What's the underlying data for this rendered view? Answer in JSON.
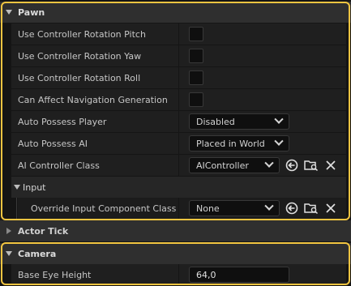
{
  "pawn": {
    "title": "Pawn",
    "rows": [
      {
        "label": "Use Controller Rotation Pitch"
      },
      {
        "label": "Use Controller Rotation Yaw"
      },
      {
        "label": "Use Controller Rotation Roll"
      },
      {
        "label": "Can Affect Navigation Generation"
      },
      {
        "label": "Auto Possess Player",
        "value": "Disabled"
      },
      {
        "label": "Auto Possess AI",
        "value": "Placed in World"
      },
      {
        "label": "AI Controller Class",
        "value": "AIController"
      }
    ],
    "input": {
      "title": "Input",
      "rows": [
        {
          "label": "Override Input Component Class",
          "value": "None"
        }
      ]
    }
  },
  "actor_tick": {
    "title": "Actor Tick"
  },
  "camera": {
    "title": "Camera",
    "rows": [
      {
        "label": "Base Eye Height",
        "value": "64,0"
      }
    ]
  },
  "colors": {
    "highlight": "#f2c541",
    "background": "#151515",
    "row": "#1f1f1f"
  },
  "icons": [
    "chevron-down-icon",
    "arrow-left-circle-icon",
    "folder-search-icon",
    "close-icon"
  ]
}
